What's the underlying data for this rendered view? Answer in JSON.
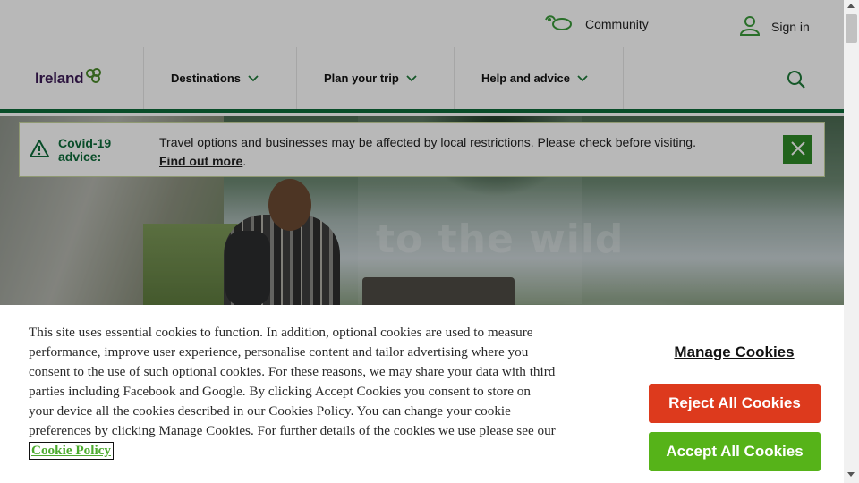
{
  "topbar": {
    "community_label": "Community",
    "signin_label": "Sign in"
  },
  "nav": {
    "logo_text": "Ireland",
    "items": [
      {
        "label": "Destinations"
      },
      {
        "label": "Plan your trip"
      },
      {
        "label": "Help and advice"
      }
    ]
  },
  "hero": {
    "overlay_word": "to the wild"
  },
  "covid": {
    "title": "Covid-19 advice:",
    "message": "Travel options and businesses may be affected by local restrictions. Please check before visiting.",
    "link": "Find out more",
    "link_suffix": "."
  },
  "cookie": {
    "text": "This site uses essential cookies to function. In addition, optional cookies are used to measure performance, improve user experience, personalise content and tailor advertising where you consent to the use of such optional cookies. For these reasons, we may share your data with third parties including Facebook and Google. By clicking Accept Cookies you consent to store on your device all the cookies described in our Cookies Policy. You can change your cookie preferences by clicking Manage Cookies. For further details of the cookies we use please see our",
    "policy_link": "Cookie Policy",
    "manage_label": "Manage Cookies",
    "reject_label": "Reject All Cookies",
    "accept_label": "Accept All Cookies"
  },
  "colors": {
    "brand_green": "#0d6b3a",
    "logo_purple": "#3b1a55",
    "reject_red": "#dd3a1d",
    "accept_green": "#56b319",
    "close_green": "#2e8a28"
  },
  "icons": [
    "community-icon",
    "user-icon",
    "shamrock-icon",
    "chevron-down-icon",
    "search-icon",
    "warning-icon",
    "close-icon"
  ]
}
